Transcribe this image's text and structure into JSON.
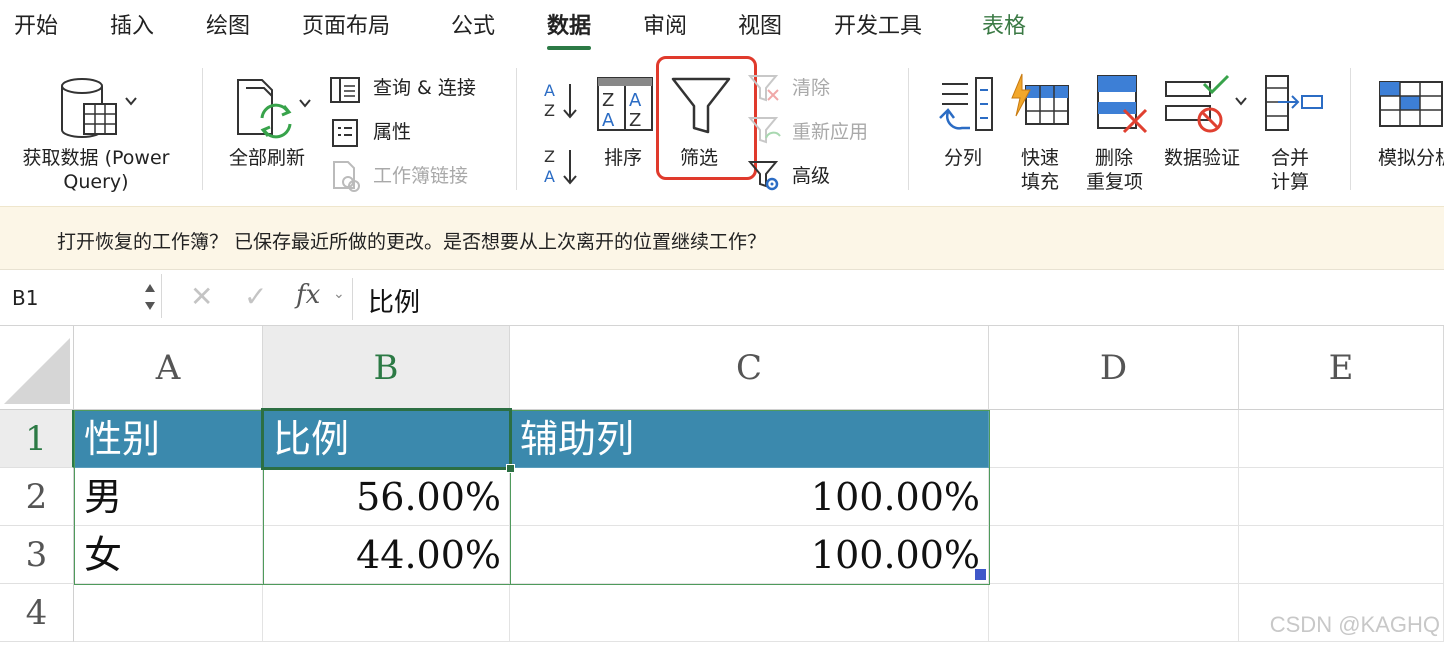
{
  "tabs": [
    "开始",
    "插入",
    "绘图",
    "页面布局",
    "公式",
    "数据",
    "审阅",
    "视图",
    "开发工具",
    "表格"
  ],
  "active_tab": "数据",
  "ribbon": {
    "get_data": "获取数据 (Power",
    "get_data_2": "Query)",
    "refresh_all": "全部刷新",
    "queries": "查询 & 连接",
    "properties": "属性",
    "workbook_links": "工作簿链接",
    "sort": "排序",
    "filter": "筛选",
    "clear": "清除",
    "reapply": "重新应用",
    "advanced": "高级",
    "text_to_columns": "分列",
    "flash_fill_1": "快速",
    "flash_fill_2": "填充",
    "remove_dup_1": "删除",
    "remove_dup_2": "重复项",
    "data_validation": "数据验证",
    "consolidate_1": "合并",
    "consolidate_2": "计算",
    "what_if": "模拟分析"
  },
  "notification": "打开恢复的工作簿？ 已保存最近所做的更改。是否想要从上次离开的位置继续工作？",
  "formula_bar": {
    "name_box": "B1",
    "value": "比例",
    "fx": "fx"
  },
  "sheet": {
    "columns": [
      "A",
      "B",
      "C",
      "D",
      "E"
    ],
    "rows": [
      "1",
      "2",
      "3",
      "4"
    ],
    "cells": {
      "a1": "性别",
      "b1": "比例",
      "c1": "辅助列",
      "a2": "男",
      "b2": "56.00%",
      "c2": "100.00%",
      "a3": "女",
      "b3": "44.00%",
      "c3": "100.00%"
    }
  },
  "watermark": "CSDN @KAGHQ",
  "colors": {
    "accent_green": "#2c7a45",
    "table_header_blue": "#3b89ad",
    "highlight_red": "#e03a2c",
    "notification_bg": "#fcf6e7"
  }
}
